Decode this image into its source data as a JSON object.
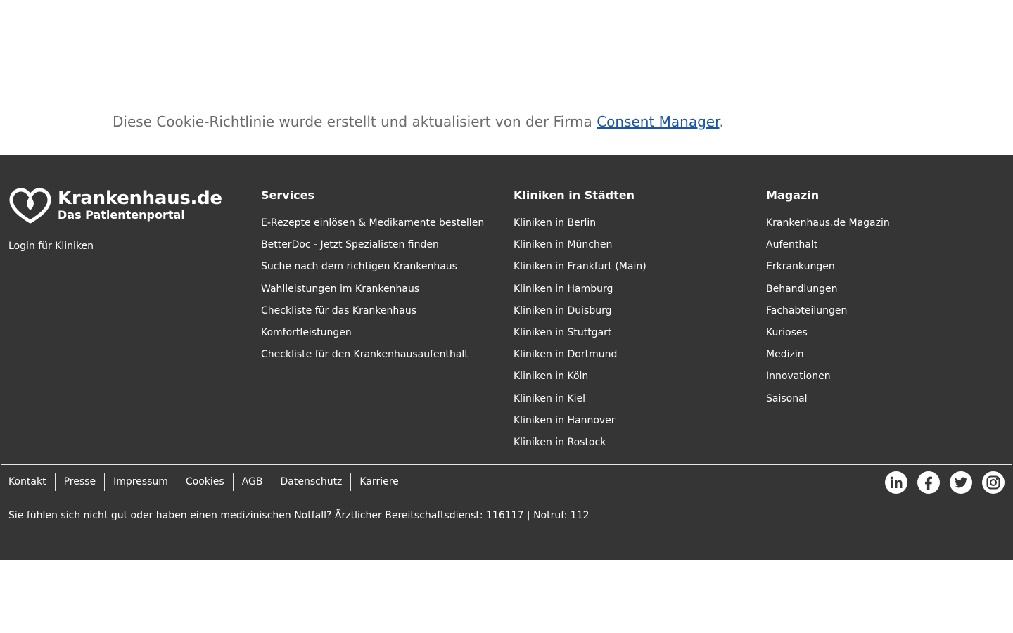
{
  "cookie_notice": {
    "text": "Diese Cookie-Richtlinie wurde erstellt und aktualisiert von der Firma",
    "link": "Consent Manager",
    "suffix": "."
  },
  "footer": {
    "logo": {
      "title": "Krankenhaus.de",
      "subtitle": "Das Patientenportal",
      "icon": "heart-logo-icon"
    },
    "login_link": "Login für Kliniken",
    "services": {
      "heading": "Services",
      "items": [
        "E-Rezepte einlösen & Medikamente bestellen",
        "BetterDoc - Jetzt Spezialisten finden",
        "Suche nach dem richtigen Krankenhaus",
        "Wahlleistungen im Krankenhaus",
        "Checkliste für das Krankenhaus",
        "Komfortleistungen",
        "Checkliste für den Krankenhausaufenthalt"
      ]
    },
    "cities": {
      "heading": "Kliniken in Städten",
      "items": [
        "Kliniken in Berlin",
        "Kliniken in München",
        "Kliniken in Frankfurt (Main)",
        "Kliniken in Hamburg",
        "Kliniken in Duisburg",
        "Kliniken in Stuttgart",
        "Kliniken in Dortmund",
        "Kliniken in Köln",
        "Kliniken in Kiel",
        "Kliniken in Hannover",
        "Kliniken in Rostock"
      ]
    },
    "magazin": {
      "heading": "Magazin",
      "items": [
        "Krankenhaus.de Magazin",
        "Aufenthalt",
        "Erkrankungen",
        "Behandlungen",
        "Fachabteilungen",
        "Kurioses",
        "Medizin",
        "Innovationen",
        "Saisonal"
      ]
    },
    "bottom_links": [
      "Kontakt",
      "Presse",
      "Impressum",
      "Cookies",
      "AGB",
      "Datenschutz",
      "Karriere"
    ],
    "social": [
      "linkedin-icon",
      "facebook-icon",
      "twitter-icon",
      "instagram-icon"
    ],
    "emergency_notice": "Sie fühlen sich nicht gut oder haben einen medizinischen Notfall? Ärztlicher Bereitschaftsdienst: 116117 | Notruf: 112"
  },
  "colors": {
    "footer_bg": "#353535",
    "link": "#1b56a6",
    "muted_text": "#6b6b6b"
  }
}
